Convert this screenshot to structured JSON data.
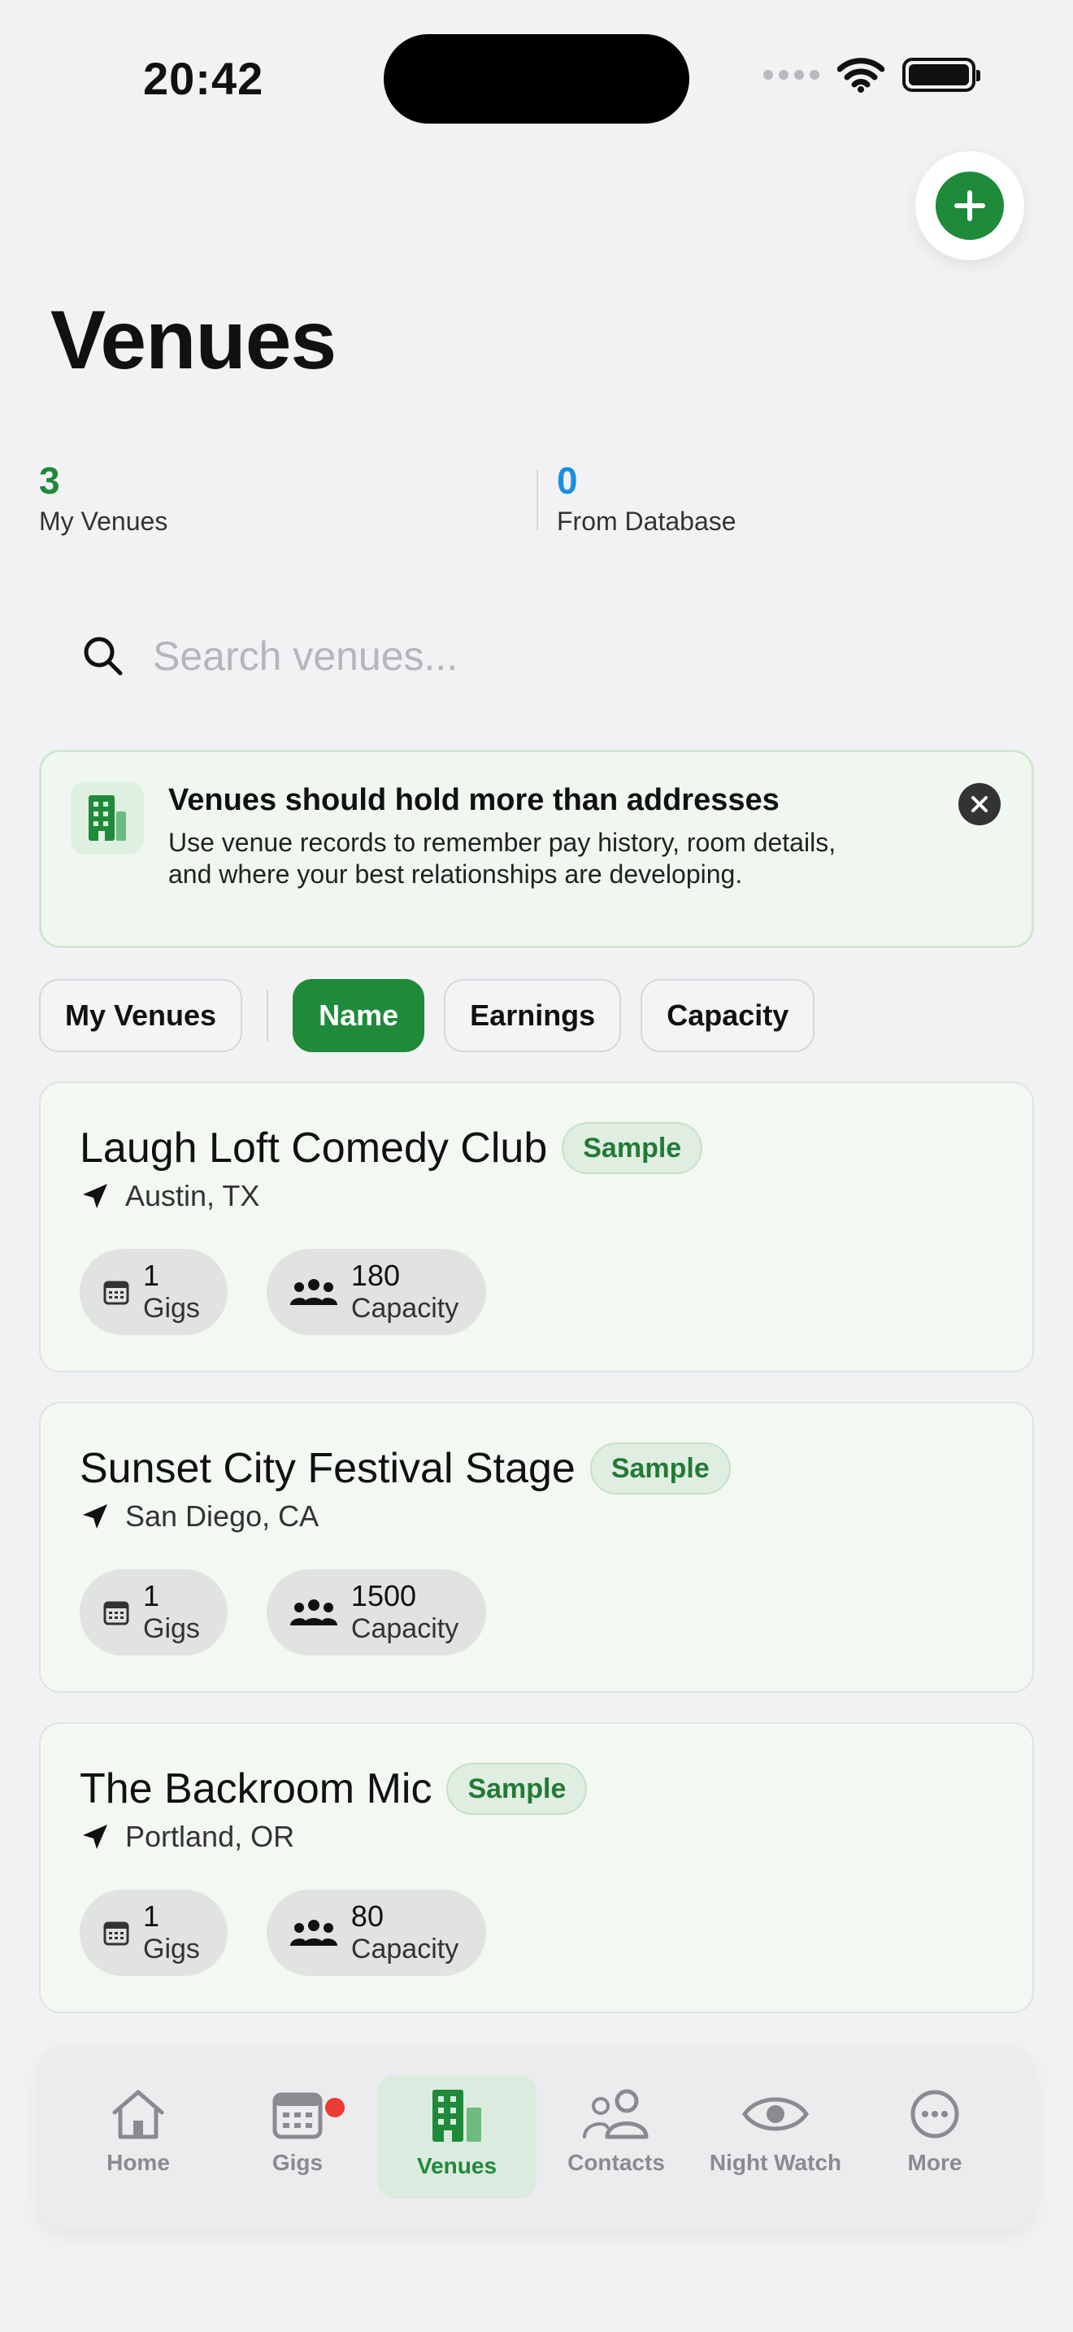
{
  "status_bar": {
    "time": "20:42"
  },
  "page": {
    "title": "Venues"
  },
  "stats": [
    {
      "value": "3",
      "label": "My Venues",
      "color": "#1f8a3a"
    },
    {
      "value": "0",
      "label": "From Database",
      "color": "#1a8fe3"
    }
  ],
  "search": {
    "placeholder": "Search venues..."
  },
  "tip": {
    "title": "Venues should hold more than addresses",
    "body": "Use venue records to remember pay history, room details, and where your best relationships are developing."
  },
  "filters": {
    "scope": "My Venues",
    "sort_options": [
      "Name",
      "Earnings",
      "Capacity"
    ],
    "active_sort": "Name"
  },
  "venues": [
    {
      "name": "Laugh Loft Comedy Club",
      "badge": "Sample",
      "location": "Austin, TX",
      "gigs": "1",
      "gigs_label": "Gigs",
      "capacity": "180",
      "capacity_label": "Capacity"
    },
    {
      "name": "Sunset City Festival Stage",
      "badge": "Sample",
      "location": "San Diego, CA",
      "gigs": "1",
      "gigs_label": "Gigs",
      "capacity": "1500",
      "capacity_label": "Capacity"
    },
    {
      "name": "The Backroom Mic",
      "badge": "Sample",
      "location": "Portland, OR",
      "gigs": "1",
      "gigs_label": "Gigs",
      "capacity": "80",
      "capacity_label": "Capacity"
    }
  ],
  "tabbar": {
    "items": [
      {
        "label": "Home",
        "icon": "house-icon"
      },
      {
        "label": "Gigs",
        "icon": "calendar-icon"
      },
      {
        "label": "Venues",
        "icon": "building-icon"
      },
      {
        "label": "Contacts",
        "icon": "people-icon"
      },
      {
        "label": "Night Watch",
        "icon": "eye-icon"
      },
      {
        "label": "More",
        "icon": "ellipsis-circle-icon"
      }
    ],
    "active": "Venues"
  },
  "colors": {
    "accent": "#1f8a3a",
    "secondary": "#1a8fe3",
    "notification": "#ef3b36"
  }
}
